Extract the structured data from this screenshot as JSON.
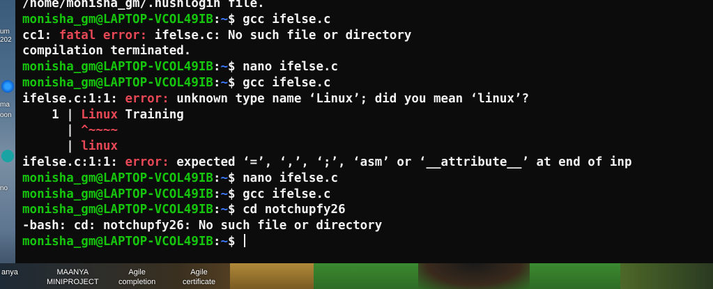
{
  "terminal": {
    "prompt": {
      "user_host": "monisha_gm@LAPTOP-VCOL49IB",
      "colon": ":",
      "path": "~",
      "symbol": "$ "
    },
    "lines": [
      {
        "type": "text",
        "text": "/home/monisha_gm/.hushlogin file."
      },
      {
        "type": "prompt",
        "command": "gcc ifelse.c"
      },
      {
        "type": "error",
        "prefix": "cc1: ",
        "label": "fatal error:",
        "rest": " ifelse.c: No such file or directory"
      },
      {
        "type": "text",
        "text": "compilation terminated."
      },
      {
        "type": "prompt",
        "command": "nano ifelse.c"
      },
      {
        "type": "prompt",
        "command": "gcc ifelse.c"
      },
      {
        "type": "error",
        "prefix": "ifelse.c:1:1: ",
        "label": "error:",
        "rest": " unknown type name ‘Linux’; did you mean ‘linux’?"
      },
      {
        "type": "source",
        "gutter": "    1 | ",
        "highlight": "Linux",
        "rest": " Training"
      },
      {
        "type": "source",
        "gutter": "      | ",
        "highlight": "^~~~~",
        "rest": ""
      },
      {
        "type": "source",
        "gutter": "      | ",
        "highlight": "linux",
        "rest": ""
      },
      {
        "type": "error",
        "prefix": "ifelse.c:1:1: ",
        "label": "error:",
        "rest": " expected ‘=’, ‘,’, ‘;’, ‘asm’ or ‘__attribute__’ at end of inp"
      },
      {
        "type": "prompt",
        "command": "nano ifelse.c"
      },
      {
        "type": "prompt",
        "command": "gcc ifelse.c"
      },
      {
        "type": "prompt",
        "command": "cd notchupfy26"
      },
      {
        "type": "text",
        "text": "-bash: cd: notchupfy26: No such file or directory"
      },
      {
        "type": "prompt",
        "command": "",
        "cursor": true
      }
    ]
  },
  "desktop": {
    "left_strip_labels": [
      "um",
      "202",
      "ma",
      "oon",
      "no"
    ],
    "bottom_labels": [
      {
        "lines": [
          "anya"
        ]
      },
      {
        "lines": [
          "MAANYA",
          "MINIPROJECT"
        ]
      },
      {
        "lines": [
          "Agile",
          "completion"
        ]
      },
      {
        "lines": [
          "Agile",
          "certificate"
        ]
      }
    ]
  },
  "colors": {
    "background": "#0c0c0c",
    "text": "#f2f2f2",
    "user_host": "#16c60c",
    "path": "#3b78ff",
    "error": "#e74856"
  }
}
